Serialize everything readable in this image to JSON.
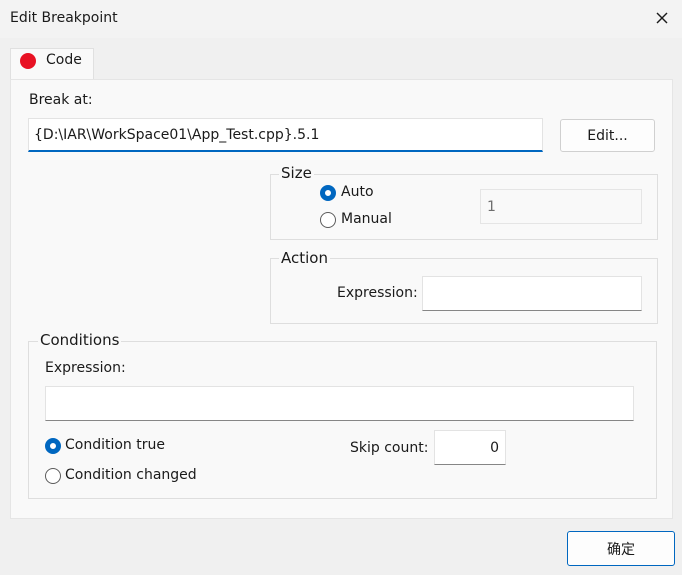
{
  "window": {
    "title": "Edit Breakpoint"
  },
  "tab": {
    "label": "Code",
    "icon": "red-dot-icon",
    "icon_color": "#e81123"
  },
  "break_at": {
    "label": "Break at:",
    "value": "{D:\\IAR\\WorkSpace01\\App_Test.cpp}.5.1",
    "edit_button": "Edit..."
  },
  "size": {
    "legend": "Size",
    "auto_label": "Auto",
    "manual_label": "Manual",
    "selected": "Auto",
    "manual_value": "1"
  },
  "action": {
    "legend": "Action",
    "expression_label": "Expression:",
    "expression_value": ""
  },
  "conditions": {
    "legend": "Conditions",
    "expression_label": "Expression:",
    "expression_value": "",
    "condition_true_label": "Condition true",
    "condition_changed_label": "Condition changed",
    "selected": "Condition true",
    "skip_count_label": "Skip count:",
    "skip_count_value": "0"
  },
  "footer": {
    "ok_button": "确定"
  },
  "colors": {
    "accent": "#0067c0",
    "breakpoint": "#e81123"
  }
}
